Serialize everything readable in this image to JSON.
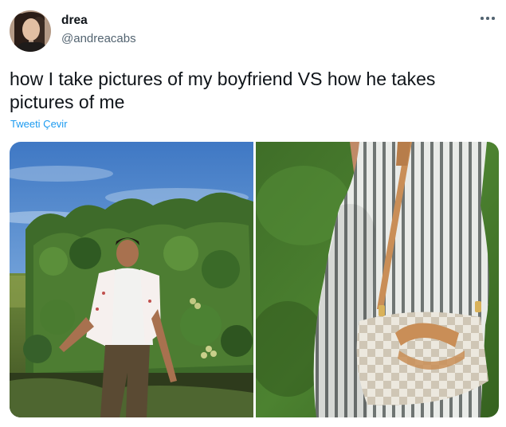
{
  "user": {
    "display_name": "drea",
    "handle": "@andreacabs",
    "avatar_icon": "profile-photo-woman-dark-hair"
  },
  "menu": {
    "more_icon": "more-horizontal-icon"
  },
  "tweet": {
    "text": "how I take pictures of my boyfriend VS how he takes pictures of me",
    "translate_label": "Tweeti Çevir"
  },
  "media": {
    "left_photo": "man-in-white-shirt-before-grapevines",
    "right_photo": "woman-striped-jumpsuit-checkered-handbag-on-grass"
  },
  "colors": {
    "link": "#1d9bf0",
    "secondary_text": "#536471",
    "primary_text": "#0f1419"
  }
}
